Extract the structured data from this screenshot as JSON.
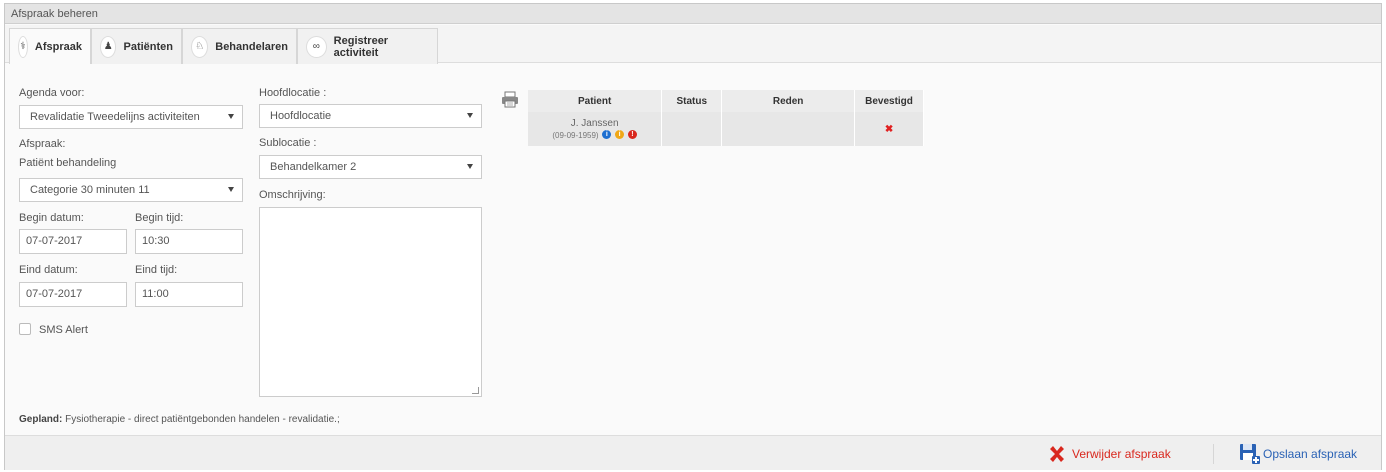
{
  "window": {
    "title": "Afspraak beheren"
  },
  "tabs": [
    {
      "label": "Afspraak",
      "icon": "stethoscope-icon"
    },
    {
      "label": "Patiënten",
      "icon": "user-icon"
    },
    {
      "label": "Behandelaren",
      "icon": "doctor-icon"
    },
    {
      "label": "Registreer activiteit",
      "icon": "link-icon"
    }
  ],
  "form": {
    "agenda_label": "Agenda voor:",
    "agenda_value": "Revalidatie Tweedelijns activiteiten",
    "afspraak_label": "Afspraak:",
    "afspraak_value": "Patiënt behandeling",
    "categorie_value": "Categorie 30 minuten 11",
    "begin_datum_label": "Begin datum:",
    "begin_datum_value": "07-07-2017",
    "begin_tijd_label": "Begin tijd:",
    "begin_tijd_value": "10:30",
    "eind_datum_label": "Eind datum:",
    "eind_datum_value": "07-07-2017",
    "eind_tijd_label": "Eind tijd:",
    "eind_tijd_value": "11:00",
    "sms_label": "SMS Alert",
    "hoofdlocatie_label": "Hoofdlocatie :",
    "hoofdlocatie_value": "Hoofdlocatie",
    "sublocatie_label": "Sublocatie :",
    "sublocatie_value": "Behandelkamer 2",
    "omschrijving_label": "Omschrijving:"
  },
  "table": {
    "headers": [
      "Patient",
      "Status",
      "Reden",
      "Bevestigd"
    ],
    "rows": [
      {
        "patient": "J. Janssen",
        "dob": "(09-09-1959)",
        "status": "",
        "reden": "",
        "bevestigd": "✖"
      }
    ],
    "info_colors": [
      "#1e6fd0",
      "#f0a818",
      "#d9281e"
    ]
  },
  "gepland": {
    "label": "Gepland:",
    "text": " Fysiotherapie - direct patiëntgebonden handelen - revalidatie.;"
  },
  "footer": {
    "delete_label": "Verwijder afspraak",
    "save_label": "Opslaan afspraak"
  },
  "colors": {
    "delete": "#d9281e",
    "save": "#2a62b5"
  }
}
